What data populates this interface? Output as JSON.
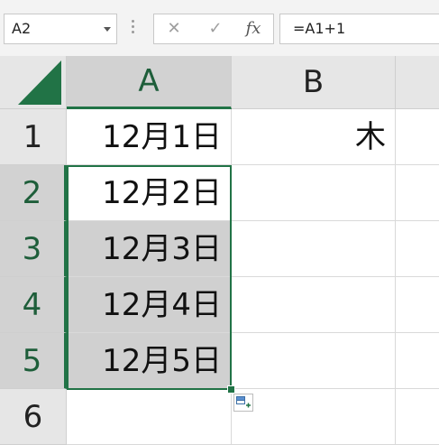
{
  "formula_bar": {
    "name_box": "A2",
    "formula": "=A1+1",
    "cancel_glyph": "✕",
    "enter_glyph": "✓",
    "insert_function_glyph": "fx"
  },
  "columns": [
    "A",
    "B"
  ],
  "rows": [
    {
      "num": "1",
      "a": "12月1日",
      "b": "木"
    },
    {
      "num": "2",
      "a": "12月2日",
      "b": ""
    },
    {
      "num": "3",
      "a": "12月3日",
      "b": ""
    },
    {
      "num": "4",
      "a": "12月4日",
      "b": ""
    },
    {
      "num": "5",
      "a": "12月5日",
      "b": ""
    },
    {
      "num": "6",
      "a": "",
      "b": ""
    }
  ],
  "selection": {
    "range": "A2:A5",
    "active_cell": "A2"
  },
  "colors": {
    "accent": "#217346",
    "header_bg": "#e6e6e6",
    "selected_header_bg": "#d2d2d2",
    "highlight_fill": "#d0d0d0"
  },
  "icons": {
    "select_all": "select-all-triangle-icon",
    "autofill": "auto-fill-options-icon"
  }
}
